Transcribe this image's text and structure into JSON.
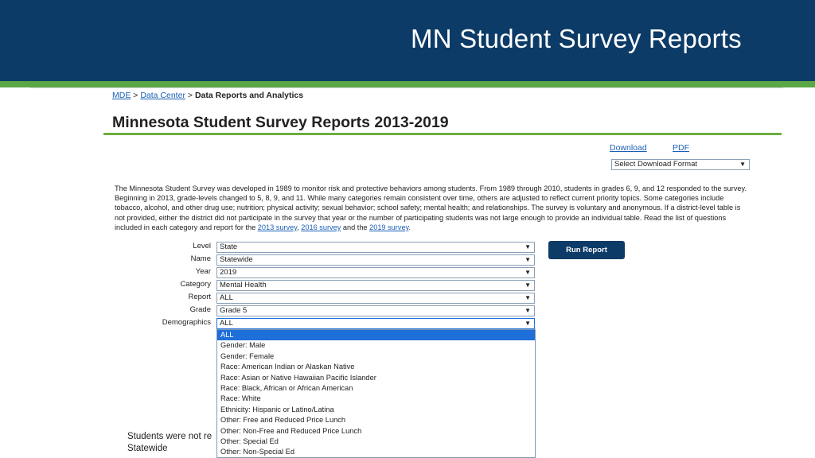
{
  "banner": {
    "title": "MN Student Survey Reports"
  },
  "breadcrumb": {
    "home": "MDE",
    "sep1": ">",
    "data_center": "Data Center",
    "sep2": ">",
    "current": "Data Reports and Analytics"
  },
  "page": {
    "heading": "Minnesota Student Survey Reports 2013-2019"
  },
  "download": {
    "download_link": "Download",
    "pdf_link": "PDF",
    "format_select": "Select Download Format"
  },
  "intro": {
    "text_1": "The Minnesota Student Survey was developed in 1989 to monitor risk and protective behaviors among students. From 1989 through 2010, students in grades 6, 9, and 12 responded to the survey. Beginning in 2013, grade-levels changed to 5, 8, 9, and 11. While many categories remain consistent over time, others are adjusted to reflect current priority topics. Some categories include tobacco, alcohol, and other drug use; nutrition; physical activity; sexual behavior; school safety; mental health; and relationships. The survey is voluntary and anonymous. If a district-level table is not provided, either the district did not participate in the survey that year or the number of participating students was not large enough to provide an individual table. Read the list of questions included in each category and report for the ",
    "link_2013": "2013 survey",
    "sep_a": ", ",
    "link_2016": "2016 survey",
    "sep_b": " and the ",
    "link_2019": "2019 survey",
    "end": "."
  },
  "form": {
    "level": {
      "label": "Level",
      "value": "State"
    },
    "name": {
      "label": "Name",
      "value": "Statewide"
    },
    "year": {
      "label": "Year",
      "value": "2019"
    },
    "category": {
      "label": "Category",
      "value": "Mental Health"
    },
    "report": {
      "label": "Report",
      "value": "ALL"
    },
    "grade": {
      "label": "Grade",
      "value": "Grade 5"
    },
    "demographics": {
      "label": "Demographics",
      "value": "ALL"
    },
    "run_button": "Run Report",
    "arrow": "▼"
  },
  "demographics_options": [
    "ALL",
    "Gender: Male",
    "Gender: Female",
    "Race: American Indian or Alaskan Native",
    "Race: Asian or Native Hawaiian Pacific Islander",
    "Race: Black, African or African American",
    "Race: White",
    "Ethnicity: Hispanic or Latino/Latina",
    "Other: Free and Reduced Price Lunch",
    "Other: Non-Free and Reduced Price Lunch",
    "Other: Special Ed",
    "Other: Non-Special Ed"
  ],
  "behind": {
    "line1": "Students were not re",
    "line2": "Statewide"
  },
  "colors": {
    "banner": "#0d3b67",
    "accent_green": "#5aa845",
    "link": "#1a5fb4",
    "selected": "#1e6fd9"
  }
}
